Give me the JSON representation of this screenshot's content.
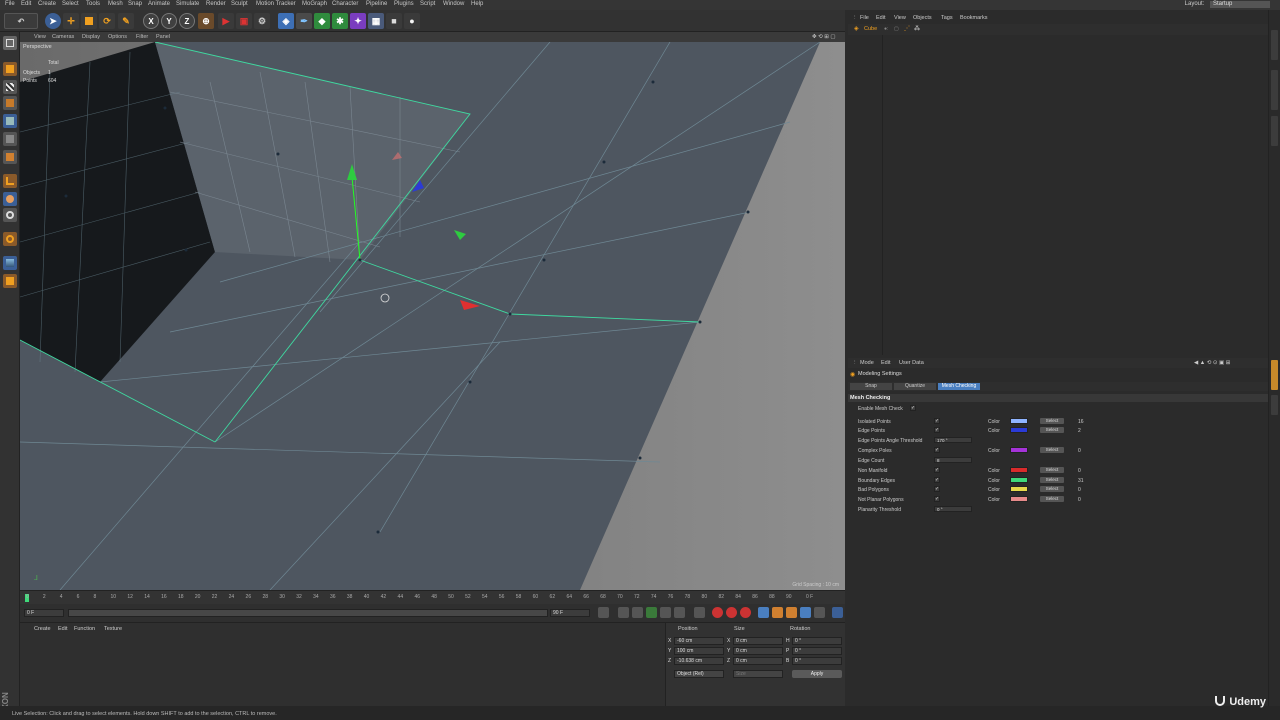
{
  "menu": {
    "items": [
      "File",
      "Edit",
      "Create",
      "Select",
      "Tools",
      "Mesh",
      "Snap",
      "Animate",
      "Simulate",
      "Render",
      "Sculpt",
      "Motion Tracker",
      "MoGraph",
      "Character",
      "Pipeline",
      "Plugins",
      "Script",
      "Window",
      "Help"
    ],
    "layout_label": "Layout:",
    "layout_value": "Startup"
  },
  "toolbar": {
    "axis_x": "X",
    "axis_y": "Y",
    "axis_z": "Z"
  },
  "viewport": {
    "menu": [
      "View",
      "Cameras",
      "Display",
      "Options",
      "Filter",
      "Panel"
    ],
    "label": "Perspective",
    "hud_total": "Total",
    "hud_objects": "Objects",
    "hud_objects_val": "1",
    "hud_points": "Points",
    "hud_points_val": "604",
    "grid_spacing": "Grid Spacing : 10 cm"
  },
  "timeline": {
    "ticks": [
      "0",
      "2",
      "4",
      "6",
      "8",
      "10",
      "12",
      "14",
      "16",
      "18",
      "20",
      "22",
      "24",
      "26",
      "28",
      "30",
      "32",
      "34",
      "36",
      "38",
      "40",
      "42",
      "44",
      "46",
      "48",
      "50",
      "52",
      "54",
      "56",
      "58",
      "60",
      "62",
      "64",
      "66",
      "68",
      "70",
      "72",
      "74",
      "76",
      "78",
      "80",
      "82",
      "84",
      "86",
      "88",
      "90"
    ],
    "end_frame": "0 F"
  },
  "transport": {
    "current": "0 F",
    "start": "0 F",
    "end": "90 F"
  },
  "material_manager": {
    "menu": [
      "Create",
      "Edit",
      "Function",
      "Texture"
    ]
  },
  "coordinates": {
    "headers": [
      "Position",
      "Size",
      "Rotation"
    ],
    "rows": [
      {
        "axis": "X",
        "pos": "-60 cm",
        "size_axis": "X",
        "size": "0 cm",
        "rot_axis": "H",
        "rot": "0 °"
      },
      {
        "axis": "Y",
        "pos": "100 cm",
        "size_axis": "Y",
        "size": "0 cm",
        "rot_axis": "P",
        "rot": "0 °"
      },
      {
        "axis": "Z",
        "pos": "-10.638 cm",
        "size_axis": "Z",
        "size": "0 cm",
        "rot_axis": "B",
        "rot": "0 °"
      }
    ],
    "mode": "Object (Rel)",
    "size_mode": "Size",
    "apply": "Apply"
  },
  "status": {
    "text": "Live Selection: Click and drag to select elements. Hold down SHIFT to add to the selection, CTRL to remove."
  },
  "watermark": "Udemy",
  "object_manager": {
    "menu": [
      "File",
      "Edit",
      "View",
      "Objects",
      "Tags",
      "Bookmarks"
    ],
    "object_name": "Cube"
  },
  "attributes": {
    "menu": [
      "Mode",
      "Edit",
      "User Data"
    ],
    "title": "Modeling Settings",
    "tabs": [
      "Snap",
      "Quantize",
      "Mesh Checking"
    ],
    "section": "Mesh Checking",
    "enable_label": "Enable Mesh Check",
    "enable_check": "✓",
    "rows": [
      {
        "label": "Isolated Points",
        "checked": "✓",
        "color_label": "Color",
        "color": "#8fb4ff",
        "select": "Select",
        "count": "16"
      },
      {
        "label": "Edge Points",
        "checked": "✓",
        "color_label": "Color",
        "color": "#2b3bd6",
        "select": "Select",
        "count": "2"
      },
      {
        "label": "Edge Points Angle Threshold",
        "spin": "170 °"
      },
      {
        "label": "Complex Poles",
        "checked": "✓",
        "color_label": "Color",
        "color": "#a533d9",
        "select": "Select",
        "count": "0"
      },
      {
        "label": "Edge Count",
        "spin": "8"
      },
      {
        "label": "Non Manifold",
        "checked": "✓",
        "color_label": "Color",
        "color": "#d92b2b",
        "select": "Select",
        "count": "0"
      },
      {
        "label": "Boundary Edges",
        "checked": "✓",
        "color_label": "Color",
        "color": "#3fd97a",
        "select": "Select",
        "count": "31"
      },
      {
        "label": "Bad Polygons",
        "checked": "✓",
        "color_label": "Color",
        "color": "#e6d94a",
        "select": "Select",
        "count": "0"
      },
      {
        "label": "Not Planar Polygons",
        "checked": "✓",
        "color_label": "Color",
        "color": "#e68a8a",
        "select": "Select",
        "count": "0"
      },
      {
        "label": "Planarity Threshold",
        "spin": "0 °"
      }
    ]
  }
}
